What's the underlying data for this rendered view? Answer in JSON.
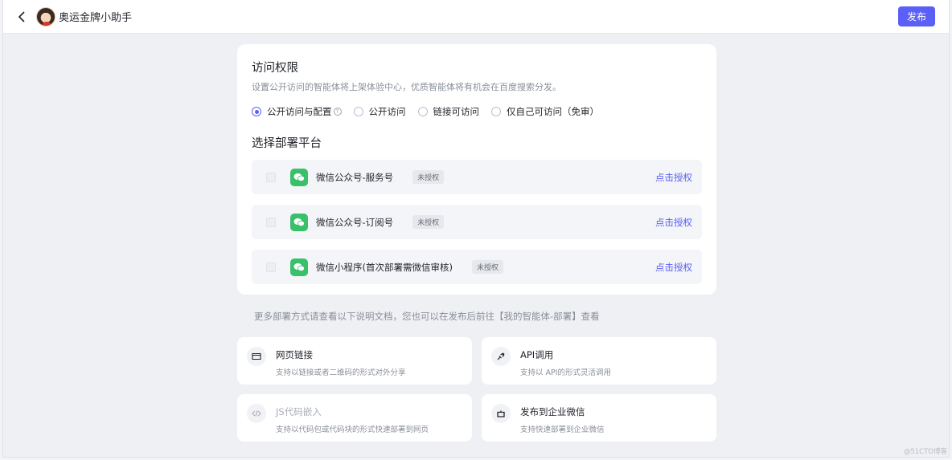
{
  "header": {
    "back_icon": "chevron-left-icon",
    "app_name": "奥运金牌小助手",
    "publish_label": "发布"
  },
  "access": {
    "title": "访问权限",
    "desc": "设置公开访问的智能体将上架体验中心，优质智能体将有机会在百度搜索分发。",
    "options": [
      {
        "label": "公开访问与配置",
        "selected": true,
        "help_icon": true
      },
      {
        "label": "公开访问",
        "selected": false
      },
      {
        "label": "链接可访问",
        "selected": false
      },
      {
        "label": "仅自己可访问（免审）",
        "selected": false
      }
    ]
  },
  "platforms": {
    "title": "选择部署平台",
    "items": [
      {
        "name": "微信公众号-服务号",
        "badge": "未授权",
        "action": "点击授权"
      },
      {
        "name": "微信公众号-订阅号",
        "badge": "未授权",
        "action": "点击授权"
      },
      {
        "name": "微信小程序(首次部署需微信审核)",
        "badge": "未授权",
        "action": "点击授权"
      }
    ]
  },
  "more_info": "更多部署方式请查看以下说明文档，您也可以在发布后前往【我的智能体-部署】查看",
  "deploy_options": [
    {
      "name": "网页链接",
      "desc": "支持以链接或者二维码的形式对外分享",
      "icon": "browser-window-icon"
    },
    {
      "name": "API调用",
      "desc": "支持以 API的形式灵活调用",
      "icon": "plug-icon"
    },
    {
      "name": "JS代码嵌入",
      "desc": "支持以代码包或代码块的形式快速部署到网页",
      "icon": "code-icon"
    },
    {
      "name": "发布到企业微信",
      "desc": "支持快速部署到企业微信",
      "icon": "robot-icon"
    }
  ],
  "watermark": "@51CTO博客",
  "colors": {
    "accent": "#5a5ff6",
    "wechat": "#39c06b"
  }
}
